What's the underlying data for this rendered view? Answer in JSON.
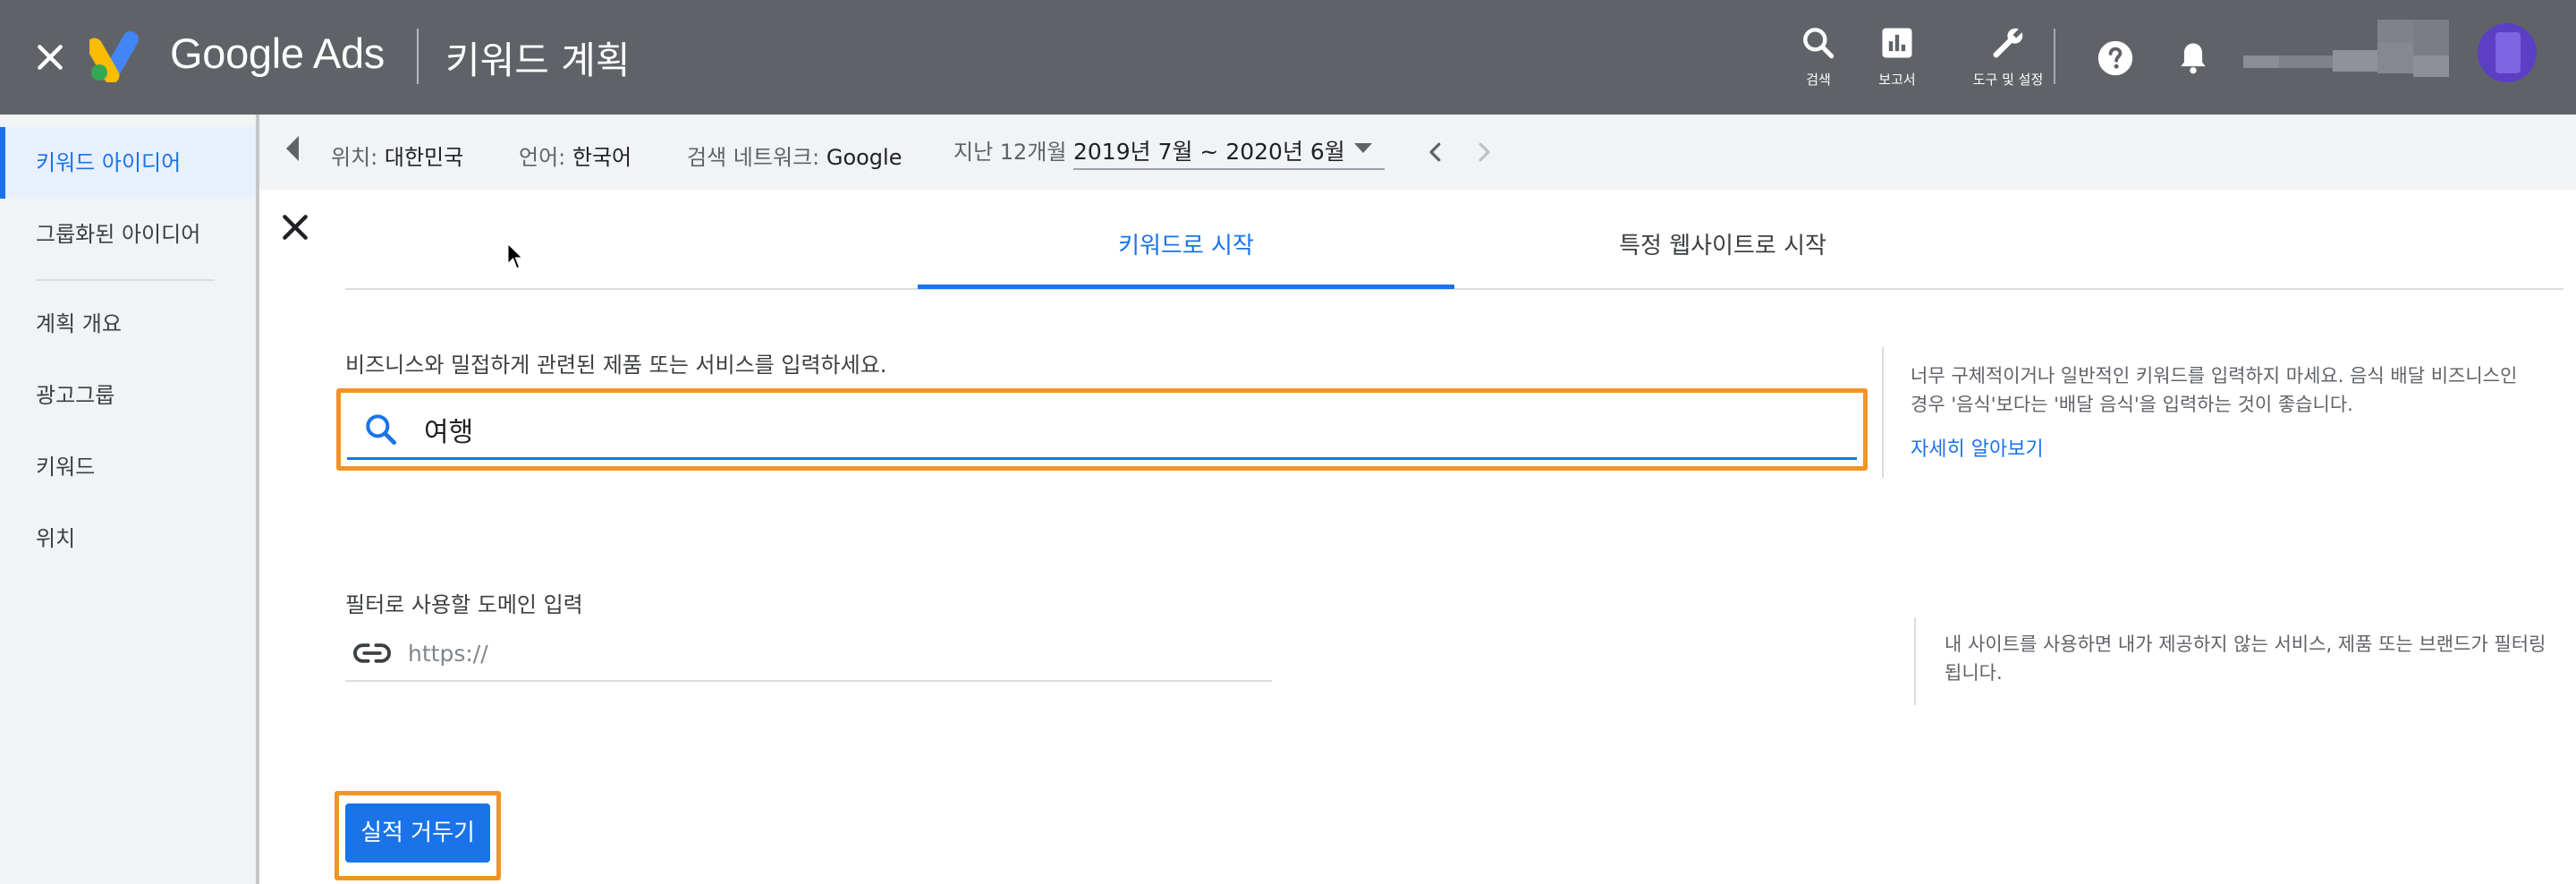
{
  "header": {
    "close_icon": "close-icon",
    "logo_text": "Google Ads",
    "page_title": "키워드 계획",
    "tools": [
      {
        "icon": "search-icon",
        "label": "검색"
      },
      {
        "icon": "bar-chart-icon",
        "label": "보고서"
      },
      {
        "icon": "wrench-icon",
        "label": "도구 및 설정"
      }
    ],
    "help_icon": "help-icon",
    "notifications_icon": "bell-icon",
    "account": {
      "name": "",
      "avatar": "avatar"
    }
  },
  "sidebar": {
    "items": [
      {
        "label": "키워드 아이디어",
        "active": true
      },
      {
        "label": "그룹화된 아이디어",
        "active": false
      },
      {
        "label": "계획 개요",
        "active": false
      },
      {
        "label": "광고그룹",
        "active": false
      },
      {
        "label": "키워드",
        "active": false
      },
      {
        "label": "위치",
        "active": false
      }
    ]
  },
  "filters": {
    "location": {
      "label": "위치:",
      "value": "대한민국"
    },
    "language": {
      "label": "언어:",
      "value": "한국어"
    },
    "network": {
      "label": "검색 네트워크:",
      "value": "Google"
    },
    "period_label": "지난 12개월",
    "date_range": "2019년 7월 ~ 2020년 6월"
  },
  "panel": {
    "tabs": [
      {
        "label": "키워드로 시작",
        "active": true
      },
      {
        "label": "특정 웹사이트로 시작",
        "active": false
      }
    ],
    "keyword_input": {
      "label": "비즈니스와 밀접하게 관련된 제품 또는 서비스를 입력하세요.",
      "value": "여행"
    },
    "tip1": "너무 구체적이거나 일반적인 키워드를 입력하지 마세요. 음식 배달 비즈니스인 경우 '음식'보다는 '배달 음식'을 입력하는 것이 좋습니다.",
    "learn_more": "자세히 알아보기",
    "domain_input": {
      "label": "필터로 사용할 도메인 입력",
      "placeholder": "https://"
    },
    "tip2": "내 사이트를 사용하면 내가 제공하지 않는 서비스, 제품 또는 브랜드가 필터링됩니다.",
    "submit_label": "실적 거두기"
  },
  "colors": {
    "header_bg": "#5f6368",
    "accent": "#1a73e8",
    "highlight": "#f29423"
  }
}
